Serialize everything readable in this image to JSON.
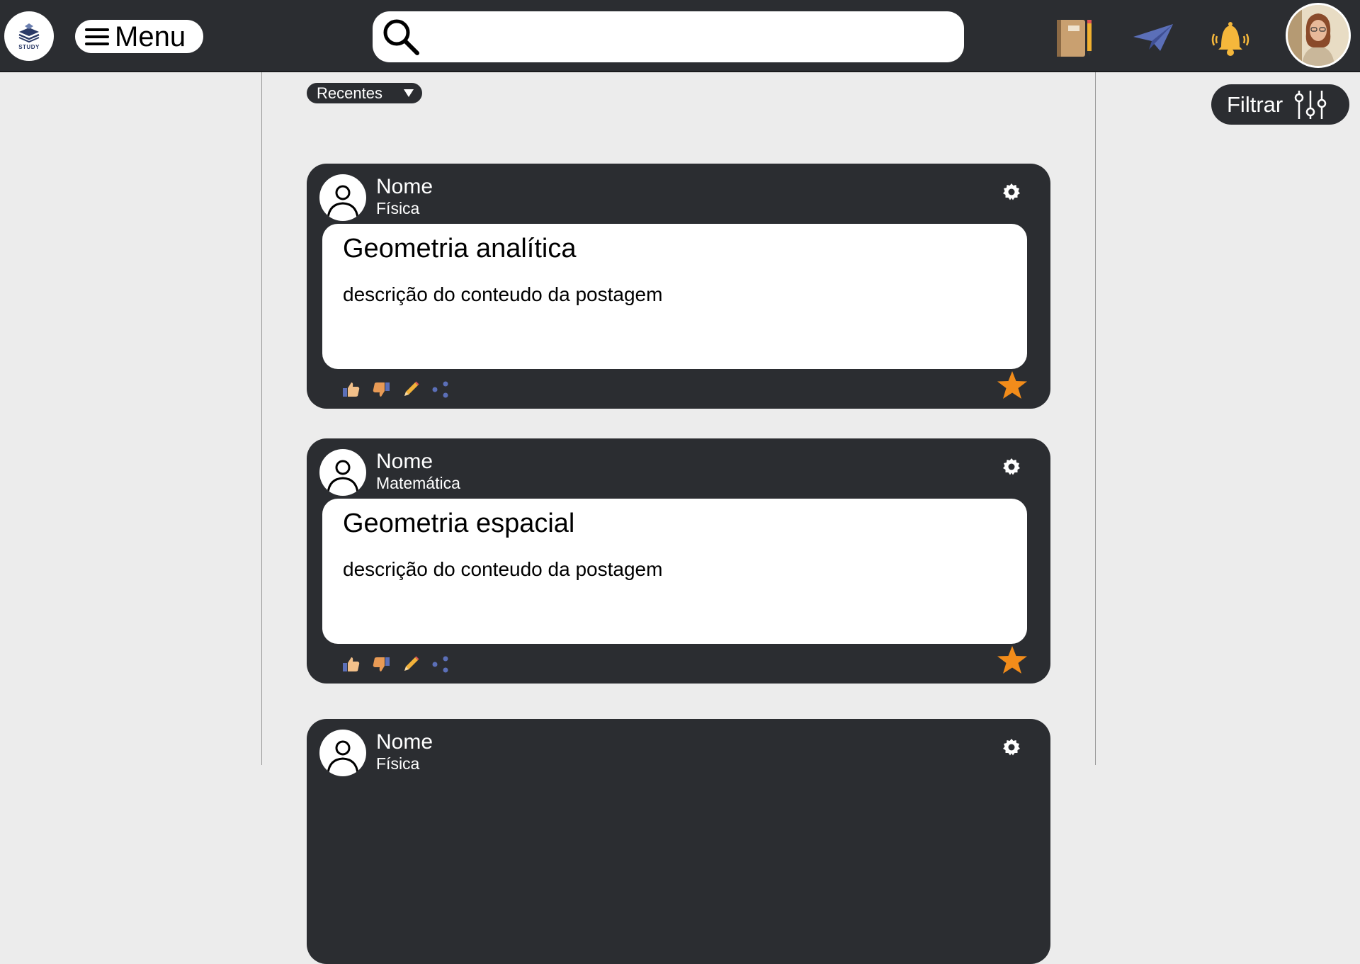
{
  "header": {
    "logo_text": "STUDY",
    "menu_label": "Menu",
    "search_placeholder": ""
  },
  "toolbar": {
    "sort_label": "Recentes",
    "filter_label": "Filtrar"
  },
  "posts": [
    {
      "author": "Nome",
      "subject": "Física",
      "title": "Geometria analítica",
      "description": "descrição do conteudo da postagem"
    },
    {
      "author": "Nome",
      "subject": "Matemática",
      "title": "Geometria espacial",
      "description": "descrição do conteudo da postagem"
    },
    {
      "author": "Nome",
      "subject": "Física",
      "title": "",
      "description": ""
    }
  ],
  "colors": {
    "topbar": "#2b2d31",
    "page_bg": "#ececec",
    "card": "#2b2d31",
    "star": "#f28c1a",
    "send": "#5b6fb8",
    "bell": "#f5b73b"
  },
  "icons": [
    "search-icon",
    "notebook-icon",
    "send-icon",
    "bell-icon",
    "settings-icon",
    "like-icon",
    "dislike-icon",
    "edit-icon",
    "share-icon",
    "favorite-star-icon",
    "filter-sliders-icon",
    "hamburger-icon"
  ]
}
